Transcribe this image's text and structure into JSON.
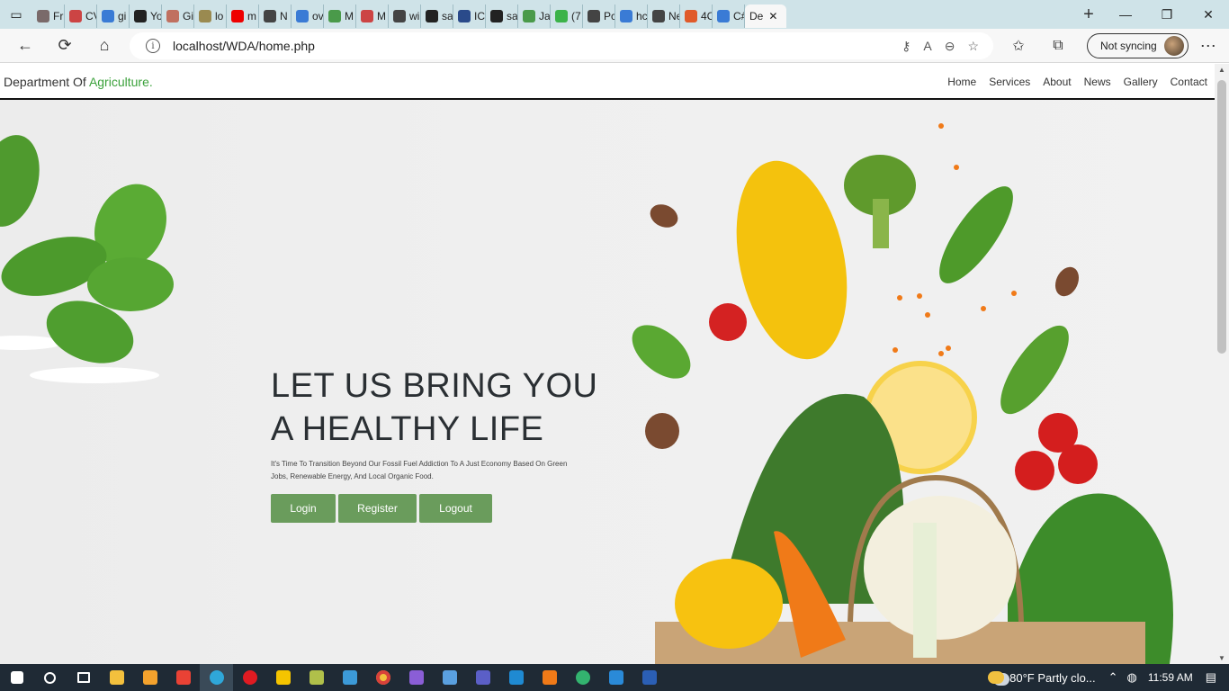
{
  "browser": {
    "tabs": [
      {
        "label": "Fri",
        "color": "#7a6a6a"
      },
      {
        "label": "CV",
        "color": "#c44"
      },
      {
        "label": "gi",
        "color": "#3a7bd5"
      },
      {
        "label": "Yo",
        "color": "#222"
      },
      {
        "label": "Gi",
        "color": "#c07060"
      },
      {
        "label": "lo",
        "color": "#9a8a50"
      },
      {
        "label": "m",
        "color": "#e00"
      },
      {
        "label": "N",
        "color": "#444"
      },
      {
        "label": "ov",
        "color": "#3a7bd5"
      },
      {
        "label": "M",
        "color": "#4a9a4a"
      },
      {
        "label": "M",
        "color": "#c44"
      },
      {
        "label": "wi",
        "color": "#444"
      },
      {
        "label": "sa",
        "color": "#222"
      },
      {
        "label": "IC",
        "color": "#2a4a8a"
      },
      {
        "label": "sa",
        "color": "#222"
      },
      {
        "label": "Ja",
        "color": "#4a9a4a"
      },
      {
        "label": "(7",
        "color": "#3cb34a"
      },
      {
        "label": "Pc",
        "color": "#444"
      },
      {
        "label": "hc",
        "color": "#3a7bd5"
      },
      {
        "label": "Ne",
        "color": "#444"
      },
      {
        "label": "4C",
        "color": "#e05a2a"
      },
      {
        "label": "C#",
        "color": "#3a7bd5"
      }
    ],
    "active_tab": {
      "label": "De"
    },
    "url": "localhost/WDA/home.php",
    "sync_label": "Not syncing"
  },
  "site": {
    "brand_prefix": "Department Of ",
    "brand_highlight": "Agriculture.",
    "nav": [
      "Home",
      "Services",
      "About",
      "News",
      "Gallery",
      "Contact"
    ],
    "headline_line1": "LET US BRING YOU",
    "headline_line2": "A HEALTHY LIFE",
    "subtext": "It's Time To Transition Beyond Our Fossil Fuel Addiction To A Just Economy Based On Green Jobs, Renewable Energy, And Local Organic Food.",
    "buttons": {
      "login": "Login",
      "register": "Register",
      "logout": "Logout"
    }
  },
  "taskbar": {
    "weather": "80°F  Partly clo...",
    "time": "11:59 AM"
  },
  "colors": {
    "accent_green": "#3ca23c",
    "button_green": "#6a9c5c"
  }
}
